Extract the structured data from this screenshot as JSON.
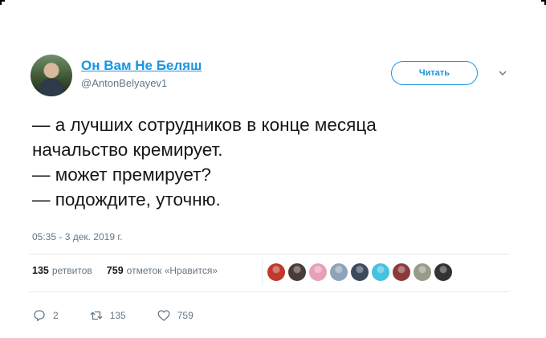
{
  "author": {
    "display_name": "Он Вам Не Беляш",
    "handle": "@AntonBelyayev1"
  },
  "follow_button_label": "Читать",
  "tweet": {
    "lines": [
      "— а лучших сотрудников в конце месяца",
      "начальство кремирует.",
      "— может премирует?",
      "— подождите, уточню."
    ],
    "timestamp": "05:35 - 3 дек. 2019 г."
  },
  "stats": {
    "retweets_count": "135",
    "retweets_label": "ретвитов",
    "likes_count": "759",
    "likes_label": "отметок «Нравится»"
  },
  "liker_avatar_colors": [
    "#c0392b",
    "#4a3b3b",
    "#e8a0b8",
    "#8fa3b8",
    "#3d4a5c",
    "#46c1e0",
    "#8b3a3a",
    "#9a9a8a",
    "#333333"
  ],
  "actions": {
    "reply_count": "2",
    "retweet_count": "135",
    "like_count": "759"
  },
  "icons": {
    "reply": "reply-icon",
    "retweet": "retweet-icon",
    "like": "heart-icon",
    "more": "chevron-down-icon"
  },
  "colors": {
    "accent": "#1b95e0",
    "secondary_text": "#657786",
    "divider": "#e1e8ed"
  }
}
